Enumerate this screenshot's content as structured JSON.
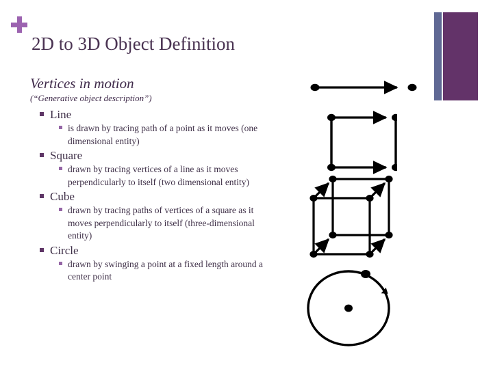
{
  "slide": {
    "title": "2D to 3D Object Definition",
    "plus_icon": "plus-icon",
    "lead_heading": "Vertices in motion",
    "sub_heading": "(“Generative object description”)",
    "bullets": [
      {
        "label": "Line",
        "detail": "is drawn by tracing path of a point as it moves (one dimensional entity)"
      },
      {
        "label": "Square",
        "detail": "drawn by tracing vertices of a line as it moves perpendicularly to itself (two dimensional entity)"
      },
      {
        "label": "Cube",
        "detail": "drawn by tracing paths of vertices of a square as it moves perpendicularly to itself (three-dimensional entity)"
      },
      {
        "label": "Circle",
        "detail": "drawn by swinging a point at a fixed length around a center point"
      }
    ]
  },
  "figures": [
    {
      "name": "line-diagram",
      "caption": "Line"
    },
    {
      "name": "square-diagram",
      "caption": "Square"
    },
    {
      "name": "cube-diagram",
      "caption": "Cube"
    },
    {
      "name": "circle-diagram",
      "caption": "Circle"
    }
  ],
  "decor": {
    "bar_blue_color": "#5f6894",
    "bar_purple_color": "#633369",
    "plus_color": "#9c63b0",
    "title_color": "#4a3352",
    "bullet_l1_color": "#5e3566",
    "bullet_l2_color": "#9566a6",
    "diagram_ink": "#000000"
  }
}
